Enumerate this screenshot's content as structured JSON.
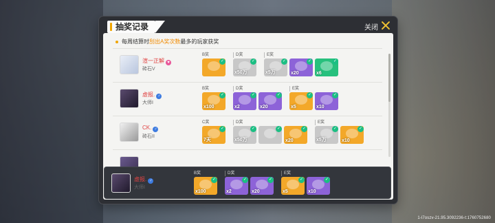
{
  "colors": {
    "accent": "#f0a500",
    "name_red": "#e04343",
    "check": "#1bbf83",
    "gold": "#f3a829",
    "purple": "#8d63d8",
    "green": "#27c07d",
    "gray": "#c8c8c8"
  },
  "dialog": {
    "title": "抽奖记录",
    "close_label": "关闭"
  },
  "notice": {
    "prefix": "每周结算时",
    "highlight": "刮出A奖次数",
    "suffix": "最多的玩家获奖"
  },
  "rows": [
    {
      "name": "渲一正解",
      "rank": "砖石V",
      "badge": "heart-badge-icon",
      "groups": [
        {
          "label": "B奖",
          "tiles": [
            {
              "q": "",
              "c": "gold",
              "icon": "key-icon"
            }
          ]
        },
        {
          "label": "D奖",
          "tiles": [
            {
              "q": "x50万",
              "c": "gray",
              "icon": "coin-icon"
            }
          ]
        },
        {
          "label": "E奖",
          "tiles": [
            {
              "q": "x5万",
              "c": "gray",
              "icon": "coin-icon"
            },
            {
              "q": "x20",
              "c": "purple",
              "icon": "gem-icon"
            },
            {
              "q": "x6",
              "c": "green",
              "icon": "potion-icon"
            }
          ]
        }
      ]
    },
    {
      "name": "虚报.",
      "rank": "大师I",
      "badge": "male-badge-icon",
      "groups": [
        {
          "label": "B奖",
          "tiles": [
            {
              "q": "x100",
              "c": "gold",
              "icon": "coin-icon"
            }
          ]
        },
        {
          "label": "D奖",
          "tiles": [
            {
              "q": "x2",
              "c": "purple",
              "icon": "chest-icon"
            },
            {
              "q": "x20",
              "c": "purple",
              "icon": "gem-icon"
            }
          ]
        },
        {
          "label": "E奖",
          "tiles": [
            {
              "q": "x5",
              "c": "gold",
              "icon": "coin-icon"
            },
            {
              "q": "x10",
              "c": "purple",
              "icon": "ticket-icon"
            }
          ]
        }
      ]
    },
    {
      "name": "CK.",
      "rank": "砖石II",
      "badge": "male-badge-icon",
      "groups": [
        {
          "label": "C奖",
          "tiles": [
            {
              "q": "7天",
              "c": "gold",
              "icon": "medal-icon"
            }
          ]
        },
        {
          "label": "D奖",
          "tiles": [
            {
              "q": "x50万",
              "c": "gray",
              "icon": "coin-icon"
            },
            {
              "q": "",
              "c": "gray",
              "icon": "chest-icon"
            },
            {
              "q": "x20",
              "c": "gold",
              "icon": "gem-icon"
            }
          ]
        },
        {
          "label": "E奖",
          "tiles": [
            {
              "q": "x5万",
              "c": "gray",
              "icon": "coin-icon"
            },
            {
              "q": "x10",
              "c": "gold",
              "icon": "coin-icon"
            }
          ]
        }
      ]
    }
  ],
  "highlight_row": {
    "name": "虚报.",
    "rank": "大师I",
    "badge": "male-badge-icon",
    "groups": [
      {
        "label": "B奖",
        "tiles": [
          {
            "q": "x100",
            "c": "gold",
            "icon": "coin-icon"
          }
        ]
      },
      {
        "label": "D奖",
        "tiles": [
          {
            "q": "x2",
            "c": "purple",
            "icon": "chest-icon"
          },
          {
            "q": "x20",
            "c": "purple",
            "icon": "gem-icon"
          }
        ]
      },
      {
        "label": "E奖",
        "tiles": [
          {
            "q": "x5",
            "c": "gold",
            "icon": "coin-icon"
          },
          {
            "q": "x10",
            "c": "purple",
            "icon": "ticket-icon"
          }
        ]
      }
    ]
  },
  "footer": "1-l7oszv-21.95.3092236-t:1760752680"
}
